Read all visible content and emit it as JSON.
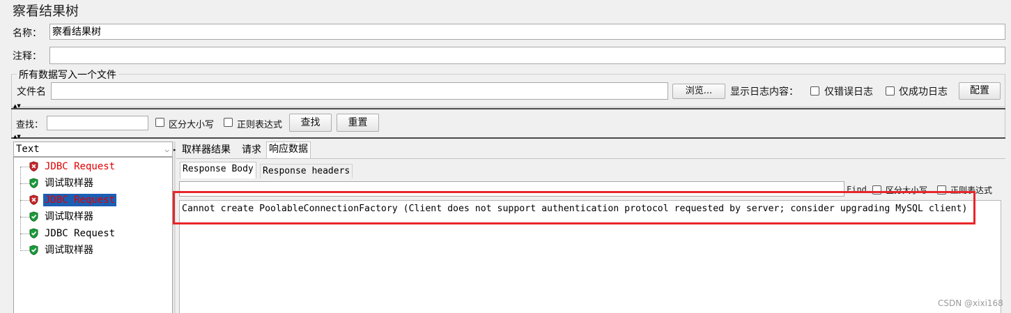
{
  "title": "察看结果树",
  "name": {
    "label": "名称：",
    "value": "察看结果树"
  },
  "comment": {
    "label": "注释：",
    "value": ""
  },
  "file_group": {
    "title": "所有数据写入一个文件",
    "filename_label": "文件名",
    "filename_value": "",
    "browse_label": "浏览...",
    "log_content_label": "显示日志内容：",
    "errors_only_label": "仅错误日志",
    "success_only_label": "仅成功日志",
    "configure_label": "配置"
  },
  "search": {
    "label": "查找：",
    "value": "",
    "case_label": "区分大小写",
    "regex_label": "正则表达式",
    "find_button": "查找",
    "reset_button": "重置"
  },
  "renderer": {
    "selected": "Text"
  },
  "tree": {
    "items": [
      {
        "label": "JDBC Request",
        "status": "error"
      },
      {
        "label": "调试取样器",
        "status": "success"
      },
      {
        "label": "JDBC Request",
        "status": "error",
        "selected": true
      },
      {
        "label": "调试取样器",
        "status": "success"
      },
      {
        "label": "JDBC Request",
        "status": "success"
      },
      {
        "label": "调试取样器",
        "status": "success"
      }
    ]
  },
  "result_tabs": [
    "取样器结果",
    "请求",
    "响应数据"
  ],
  "response_tabs": [
    "Response Body",
    "Response headers"
  ],
  "response_find": {
    "label": "Find",
    "case_label": "区分大小写",
    "regex_label": "正则表达式"
  },
  "response_body": "Cannot create PoolableConnectionFactory (Client does not support authentication protocol requested by server; consider upgrading MySQL client)",
  "watermark": "CSDN @xixi168",
  "colors": {
    "error_text": "#e00000",
    "selection_bg": "#1a5fb4",
    "highlight_box": "#e8262a",
    "success_icon": "#1a9b3a",
    "error_icon": "#c8262a"
  }
}
